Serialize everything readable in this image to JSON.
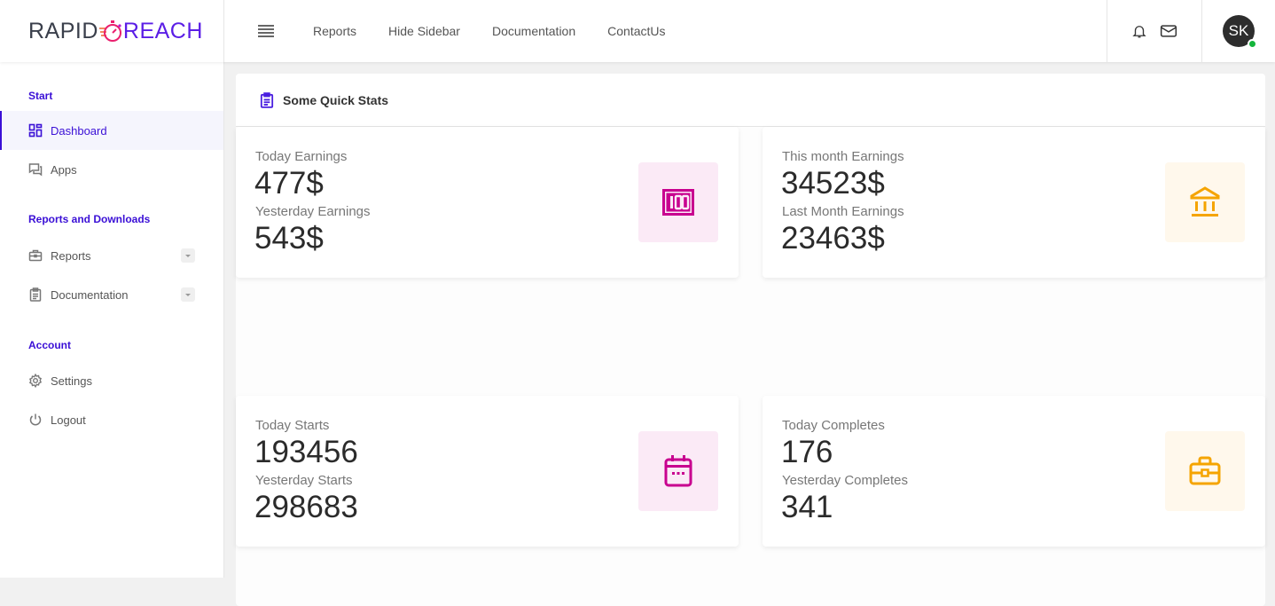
{
  "brand": {
    "name_left": "RAPID",
    "name_right": "REACH",
    "left_color": "#3a3f4b",
    "right_color": "#5b1ee6",
    "accent": "#ea1f6e"
  },
  "header": {
    "menu_icon": "hamburger-icon",
    "nav": [
      "Reports",
      "Hide Sidebar",
      "Documentation",
      "ContactUs"
    ],
    "icons": [
      "bell-icon",
      "mail-icon"
    ],
    "user": {
      "initials": "SK",
      "status": "online",
      "status_color": "#14b53c"
    }
  },
  "sidebar": {
    "sections": [
      {
        "title": "Start",
        "items": [
          {
            "label": "Dashboard",
            "icon": "dashboard-grid-icon",
            "active": true
          },
          {
            "label": "Apps",
            "icon": "chat-icon"
          }
        ]
      },
      {
        "title": "Reports and Downloads",
        "items": [
          {
            "label": "Reports",
            "icon": "briefcase-icon",
            "expandable": true
          },
          {
            "label": "Documentation",
            "icon": "clipboard-icon",
            "expandable": true
          }
        ]
      },
      {
        "title": "Account",
        "items": [
          {
            "label": "Settings",
            "icon": "gear-icon"
          },
          {
            "label": "Logout",
            "icon": "power-icon"
          }
        ]
      }
    ],
    "accent": "#3a0fd6"
  },
  "main": {
    "title": "Some Quick Stats",
    "title_icon": "clipboard-list-icon",
    "stats": [
      {
        "label1": "Today Earnings",
        "value1": "477$",
        "label2": "Yesterday Earnings",
        "value2": "543$",
        "icon": "cash-100-icon",
        "color": "#c8008f"
      },
      {
        "label1": "This month Earnings",
        "value1": "34523$",
        "label2": "Last Month Earnings",
        "value2": "23463$",
        "icon": "bank-icon",
        "color": "#f5a400"
      },
      {
        "label1": "Today Starts",
        "value1": "193456",
        "label2": "Yesterday Starts",
        "value2": "298683",
        "icon": "calendar-icon",
        "color": "#c8008f"
      },
      {
        "label1": "Today Completes",
        "value1": "176",
        "label2": "Yesterday Completes",
        "value2": "341",
        "icon": "briefcase-icon",
        "color": "#f5a400"
      }
    ]
  }
}
